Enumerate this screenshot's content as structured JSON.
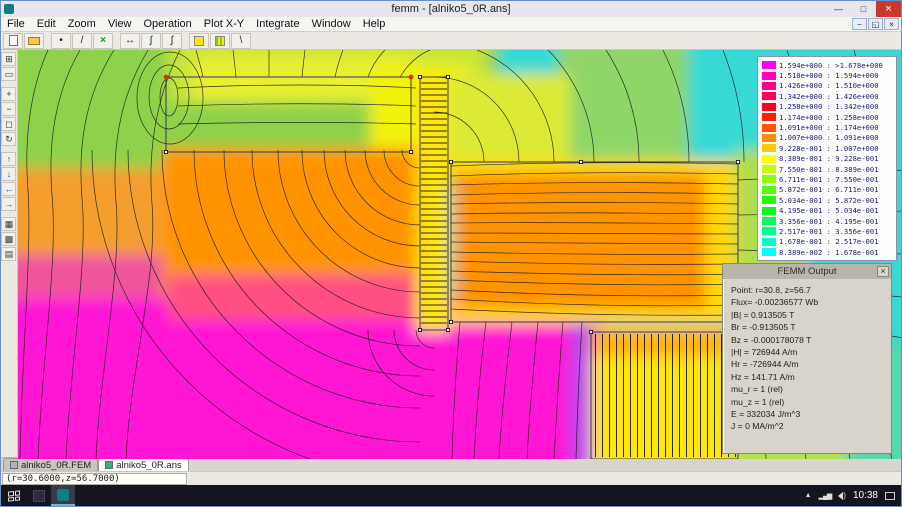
{
  "titlebar": {
    "title": "femm - [alniko5_0R.ans]",
    "minimize": "—",
    "maximize": "□",
    "close": "×"
  },
  "menubar": {
    "items": [
      "File",
      "Edit",
      "Zoom",
      "View",
      "Operation",
      "Plot X-Y",
      "Integrate",
      "Window",
      "Help"
    ],
    "mdi_minimize": "−",
    "mdi_restore": "◱",
    "mdi_close": "×"
  },
  "toolbar": {
    "buttons": [
      {
        "name": "new-file",
        "glyph": ""
      },
      {
        "name": "open-file",
        "glyph": ""
      },
      {
        "name": "node-tool",
        "glyph": "•"
      },
      {
        "name": "segment-tool",
        "glyph": "/"
      },
      {
        "name": "mesh-delete-tool",
        "glyph": "×"
      },
      {
        "name": "move-tool",
        "glyph": "↔"
      },
      {
        "name": "block-integral-tool",
        "glyph": "∫"
      },
      {
        "name": "line-integral-tool",
        "glyph": "∫"
      },
      {
        "name": "density-plot-toggle",
        "glyph": ""
      },
      {
        "name": "vector-plot-toggle",
        "glyph": ""
      },
      {
        "name": "contour-plot-toggle",
        "glyph": "\\"
      }
    ]
  },
  "sidebar": {
    "buttons": [
      {
        "name": "zoom-natural",
        "glyph": "⊞"
      },
      {
        "name": "zoom-keyboard",
        "glyph": "▭"
      },
      {
        "name": "zoom-in",
        "glyph": "+"
      },
      {
        "name": "zoom-out",
        "glyph": "−"
      },
      {
        "name": "zoom-window",
        "glyph": "◻"
      },
      {
        "name": "zoom-extents",
        "glyph": "↻"
      },
      {
        "name": "pan-up",
        "glyph": "↑"
      },
      {
        "name": "pan-down",
        "glyph": "↓"
      },
      {
        "name": "pan-left",
        "glyph": "←"
      },
      {
        "name": "pan-right",
        "glyph": "→"
      },
      {
        "name": "grid-toggle",
        "glyph": "▦"
      },
      {
        "name": "snap-grid-toggle",
        "glyph": "▩"
      },
      {
        "name": "grid-settings",
        "glyph": "▤"
      }
    ]
  },
  "legend": {
    "rows": [
      {
        "color": "#ff00ff",
        "label": "1.594e+000 : >1.678e+000"
      },
      {
        "color": "#ff00c8",
        "label": "1.510e+000 : 1.594e+000"
      },
      {
        "color": "#ff008c",
        "label": "1.426e+000 : 1.510e+000"
      },
      {
        "color": "#ff0055",
        "label": "1.342e+000 : 1.426e+000"
      },
      {
        "color": "#ff001e",
        "label": "1.258e+000 : 1.342e+000"
      },
      {
        "color": "#ff1e00",
        "label": "1.174e+000 : 1.258e+000"
      },
      {
        "color": "#ff5500",
        "label": "1.091e+000 : 1.174e+000"
      },
      {
        "color": "#ff8c00",
        "label": "1.007e+000 : 1.091e+000"
      },
      {
        "color": "#ffc800",
        "label": "9.228e-001 : 1.007e+000"
      },
      {
        "color": "#ffff00",
        "label": "8.389e-001 : 9.228e-001"
      },
      {
        "color": "#c8ff00",
        "label": "7.550e-001 : 8.389e-001"
      },
      {
        "color": "#8cff00",
        "label": "6.711e-001 : 7.550e-001"
      },
      {
        "color": "#55ff00",
        "label": "5.872e-001 : 6.711e-001"
      },
      {
        "color": "#1eff00",
        "label": "5.034e-001 : 5.872e-001"
      },
      {
        "color": "#00ff1e",
        "label": "4.195e-001 : 5.034e-001"
      },
      {
        "color": "#00ff55",
        "label": "3.356e-001 : 4.195e-001"
      },
      {
        "color": "#00ff8c",
        "label": "2.517e-001 : 3.356e-001"
      },
      {
        "color": "#00ffc8",
        "label": "1.678e-001 : 2.517e-001"
      },
      {
        "color": "#00ffff",
        "label": "8.389e-002 : 1.678e-001"
      }
    ]
  },
  "output_panel": {
    "title": "FEMM Output",
    "close": "×",
    "lines": [
      {
        "text": "Point: r=30.8, z=56.7"
      },
      {
        "text": "Flux= -0.00236577 Wb"
      },
      {
        "text": "|B| = 0.913505 T"
      },
      {
        "text": "Br = -0.913505 T"
      },
      {
        "text": "Bz = -0.000178078 T"
      },
      {
        "text": "|H| = 726944 A/m"
      },
      {
        "text": "Hr = -726944 A/m"
      },
      {
        "text": "Hz = 141.71 A/m"
      },
      {
        "text": "mu_r = 1 (rel)"
      },
      {
        "text": "mu_z = 1 (rel)"
      },
      {
        "text": "E = 332034 J/m^3"
      },
      {
        "text": "J = 0 MA/m^2"
      }
    ]
  },
  "tabs": [
    {
      "label": "alniko5_0R.FEM"
    },
    {
      "label": "alniko5_0R.ans"
    }
  ],
  "statusbar": {
    "coords": "(r=30.6000,z=56.7000)"
  },
  "taskbar": {
    "time": "10:38"
  }
}
